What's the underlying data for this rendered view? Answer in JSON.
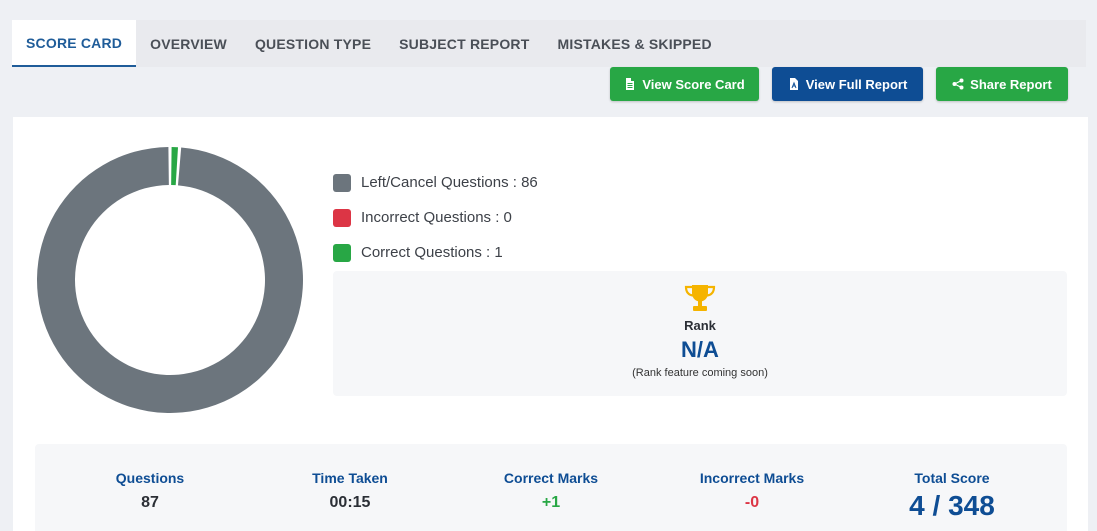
{
  "tabs": [
    {
      "label": "SCORE CARD",
      "active": true
    },
    {
      "label": "OVERVIEW"
    },
    {
      "label": "QUESTION TYPE"
    },
    {
      "label": "SUBJECT REPORT"
    },
    {
      "label": "MISTAKES & SKIPPED"
    }
  ],
  "toolbar": {
    "view_score_card": "View Score Card",
    "view_full_report": "View Full Report",
    "share_report": "Share Report"
  },
  "colors": {
    "left": "#6c757d",
    "incorrect": "#dc3545",
    "correct": "#28a745",
    "primary": "#0e4d94",
    "trophy": "#f5b400"
  },
  "legend": [
    {
      "label": "Left/Cancel Questions : 86",
      "color": "#6c757d"
    },
    {
      "label": "Incorrect Questions : 0",
      "color": "#dc3545"
    },
    {
      "label": "Correct Questions : 1",
      "color": "#28a745"
    }
  ],
  "chart_data": {
    "type": "pie",
    "categories": [
      "Left/Cancel Questions",
      "Incorrect Questions",
      "Correct Questions"
    ],
    "values": [
      86,
      0,
      1
    ]
  },
  "rank": {
    "label": "Rank",
    "value": "N/A",
    "note": "(Rank feature coming soon)"
  },
  "stats": [
    {
      "label": "Questions",
      "value": "87",
      "kind": ""
    },
    {
      "label": "Time Taken",
      "value": "00:15",
      "kind": ""
    },
    {
      "label": "Correct Marks",
      "value": "+1",
      "kind": "pos"
    },
    {
      "label": "Incorrect Marks",
      "value": "-0",
      "kind": "neg"
    },
    {
      "label": "Total Score",
      "value": "4 / 348",
      "kind": "big"
    }
  ]
}
